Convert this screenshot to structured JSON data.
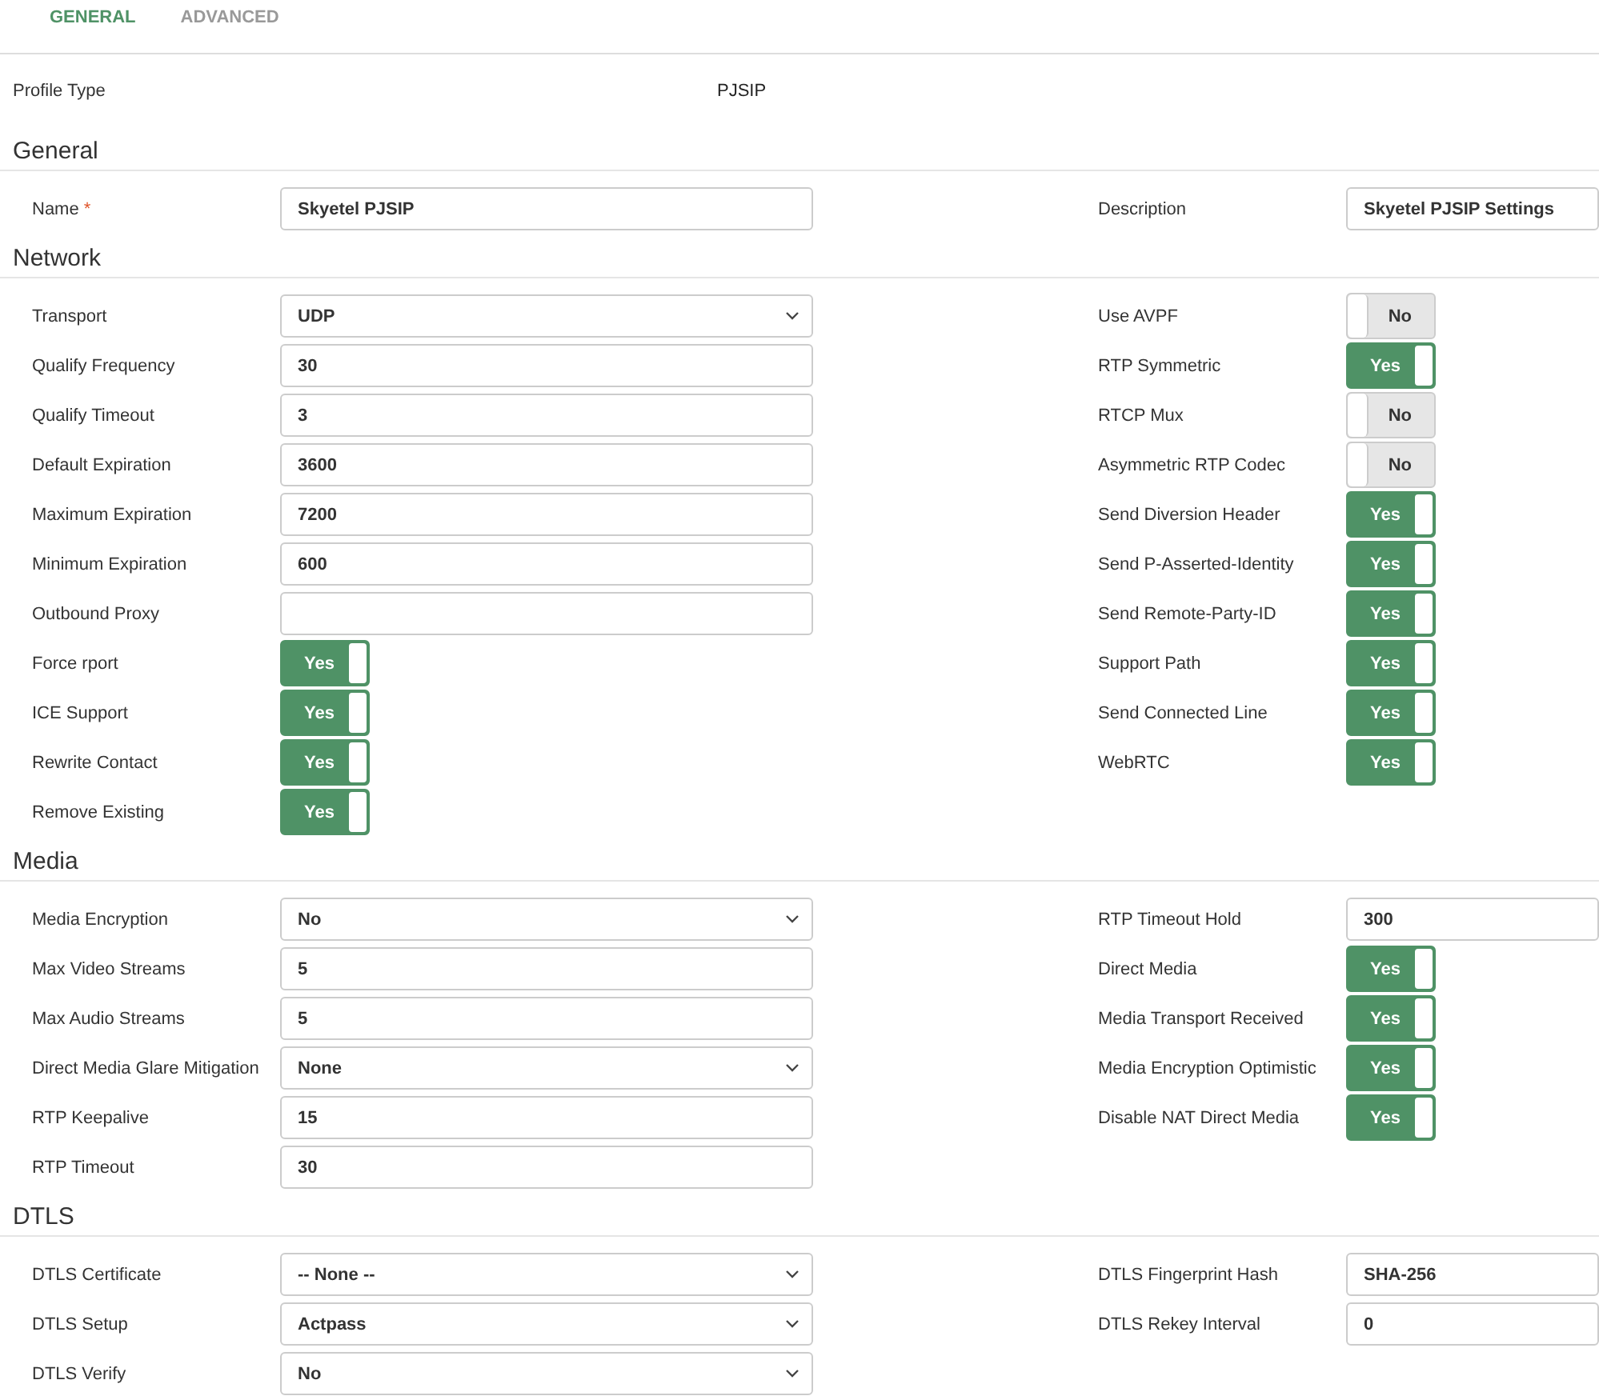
{
  "tabs": [
    {
      "label": "GENERAL",
      "selected": true
    },
    {
      "label": "ADVANCED",
      "selected": false
    }
  ],
  "profile_type": {
    "label": "Profile Type",
    "value": "PJSIP"
  },
  "sections": [
    {
      "title": "General",
      "left": [
        {
          "kind": "text",
          "label": "Name",
          "required_mark": "*",
          "value": "Skyetel PJSIP"
        }
      ],
      "right": [
        {
          "kind": "text",
          "label": "Description",
          "value": "Skyetel PJSIP Settings"
        }
      ]
    },
    {
      "title": "Network",
      "left": [
        {
          "kind": "select",
          "label": "Transport",
          "value": "UDP"
        },
        {
          "kind": "text",
          "label": "Qualify Frequency",
          "value": "30"
        },
        {
          "kind": "text",
          "label": "Qualify Timeout",
          "value": "3"
        },
        {
          "kind": "text",
          "label": "Default Expiration",
          "value": "3600"
        },
        {
          "kind": "text",
          "label": "Maximum Expiration",
          "value": "7200"
        },
        {
          "kind": "text",
          "label": "Minimum Expiration",
          "value": "600"
        },
        {
          "kind": "text",
          "label": "Outbound Proxy"
        },
        {
          "kind": "toggle",
          "label": "Force rport",
          "value": "Yes",
          "on": true
        },
        {
          "kind": "toggle",
          "label": "ICE Support",
          "value": "Yes",
          "on": true
        },
        {
          "kind": "toggle",
          "label": "Rewrite Contact",
          "value": "Yes",
          "on": true
        },
        {
          "kind": "toggle",
          "label": "Remove Existing",
          "value": "Yes",
          "on": true
        }
      ],
      "right": [
        {
          "kind": "toggle",
          "label": "Use AVPF",
          "value": "No",
          "on": false
        },
        {
          "kind": "toggle",
          "label": "RTP Symmetric",
          "value": "Yes",
          "on": true
        },
        {
          "kind": "toggle",
          "label": "RTCP Mux",
          "value": "No",
          "on": false
        },
        {
          "kind": "toggle",
          "label": "Asymmetric RTP Codec",
          "value": "No",
          "on": false
        },
        {
          "kind": "toggle",
          "label": "Send Diversion Header",
          "value": "Yes",
          "on": true
        },
        {
          "kind": "toggle",
          "label": "Send P-Asserted-Identity",
          "value": "Yes",
          "on": true
        },
        {
          "kind": "toggle",
          "label": "Send Remote-Party-ID",
          "value": "Yes",
          "on": true
        },
        {
          "kind": "toggle",
          "label": "Support Path",
          "value": "Yes",
          "on": true
        },
        {
          "kind": "toggle",
          "label": "Send Connected Line",
          "value": "Yes",
          "on": true
        },
        {
          "kind": "toggle",
          "label": "WebRTC",
          "value": "Yes",
          "on": true
        }
      ]
    },
    {
      "title": "Media",
      "left": [
        {
          "kind": "select",
          "label": "Media Encryption",
          "value": "No"
        },
        {
          "kind": "text",
          "label": "Max Video Streams",
          "value": "5"
        },
        {
          "kind": "text",
          "label": "Max Audio Streams",
          "value": "5"
        },
        {
          "kind": "select",
          "label": "Direct Media Glare Mitigation",
          "value": "None"
        },
        {
          "kind": "text",
          "label": "RTP Keepalive",
          "value": "15"
        },
        {
          "kind": "text",
          "label": "RTP Timeout",
          "value": "30"
        }
      ],
      "right": [
        {
          "kind": "text",
          "label": "RTP Timeout Hold",
          "value": "300"
        },
        {
          "kind": "toggle",
          "label": "Direct Media",
          "value": "Yes",
          "on": true
        },
        {
          "kind": "toggle",
          "label": "Media Transport Received",
          "value": "Yes",
          "on": true
        },
        {
          "kind": "toggle",
          "label": "Media Encryption Optimistic",
          "value": "Yes",
          "on": true
        },
        {
          "kind": "toggle",
          "label": "Disable NAT Direct Media",
          "value": "Yes",
          "on": true
        }
      ]
    },
    {
      "title": "DTLS",
      "left": [
        {
          "kind": "select",
          "label": "DTLS Certificate",
          "value": "-- None --"
        },
        {
          "kind": "select",
          "label": "DTLS Setup",
          "value": "Actpass"
        },
        {
          "kind": "select",
          "label": "DTLS Verify",
          "value": "No"
        }
      ],
      "right": [
        {
          "kind": "text",
          "label": "DTLS Fingerprint Hash",
          "value": "SHA-256"
        },
        {
          "kind": "text",
          "label": "DTLS Rekey Interval",
          "value": "0"
        }
      ]
    }
  ]
}
